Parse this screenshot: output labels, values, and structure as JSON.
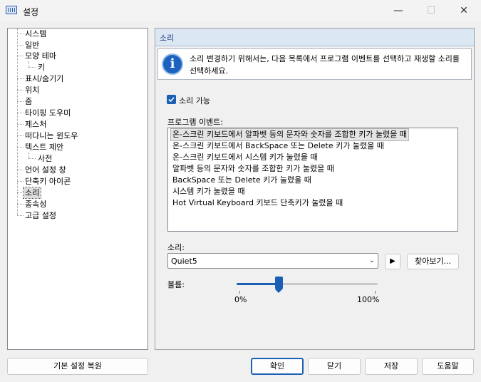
{
  "window": {
    "title": "설정",
    "minimize": "—",
    "maximize": "☐",
    "close": "✕"
  },
  "tree": {
    "items": [
      "시스템",
      "일반",
      "모양 테마",
      "키",
      "표시/숨기기",
      "위치",
      "줌",
      "타이핑 도우미",
      "제스처",
      "떠다니는 윈도우",
      "텍스트 제안",
      "사전",
      "언어 설정 창",
      "단축키 아이콘",
      "소리",
      "종속성",
      "고급 설정"
    ],
    "selected": "소리"
  },
  "panel": {
    "title": "소리",
    "info": "소리 변경하기 위해서는, 다음 목록에서 프로그램 이벤트를 선택하고 재생할 소리를 선택하세요.",
    "enable_sound": {
      "label": "소리 가능",
      "checked": true
    },
    "events_label": "프로그램 이벤트:",
    "events": [
      "온-스크린 키보드에서 알파벳 등의 문자와 숫자를 조합한 키가 눌렸을 때",
      "온-스크린 키보드에서 BackSpace 또는 Delete 키가 눌렸을 때",
      "온-스크린 키보드에서 시스템 키가 눌렸을 때",
      "알파벳 등의 문자와 숫자를 조합한 키가 눌렸을 때",
      "BackSpace 또는 Delete 키가 눌렸을 때",
      "시스템 키가 눌렸을 때",
      "Hot Virtual Keyboard 키보드 단축키가 눌렸을 때"
    ],
    "selected_event_index": 0,
    "sound_label": "소리:",
    "sound_value": "Quiet5",
    "play_icon": "play-icon",
    "browse_label": "찾아보기...",
    "volume_label": "볼륨:",
    "volume_min": "0%",
    "volume_max": "100%",
    "volume_fraction": 0.3
  },
  "buttons": {
    "reset": "기본 설정 복원",
    "ok": "확인",
    "close": "닫기",
    "save": "저장",
    "help": "도움말"
  },
  "colors": {
    "accent": "#1a5fb4",
    "header_bg": "#dce7f4"
  }
}
